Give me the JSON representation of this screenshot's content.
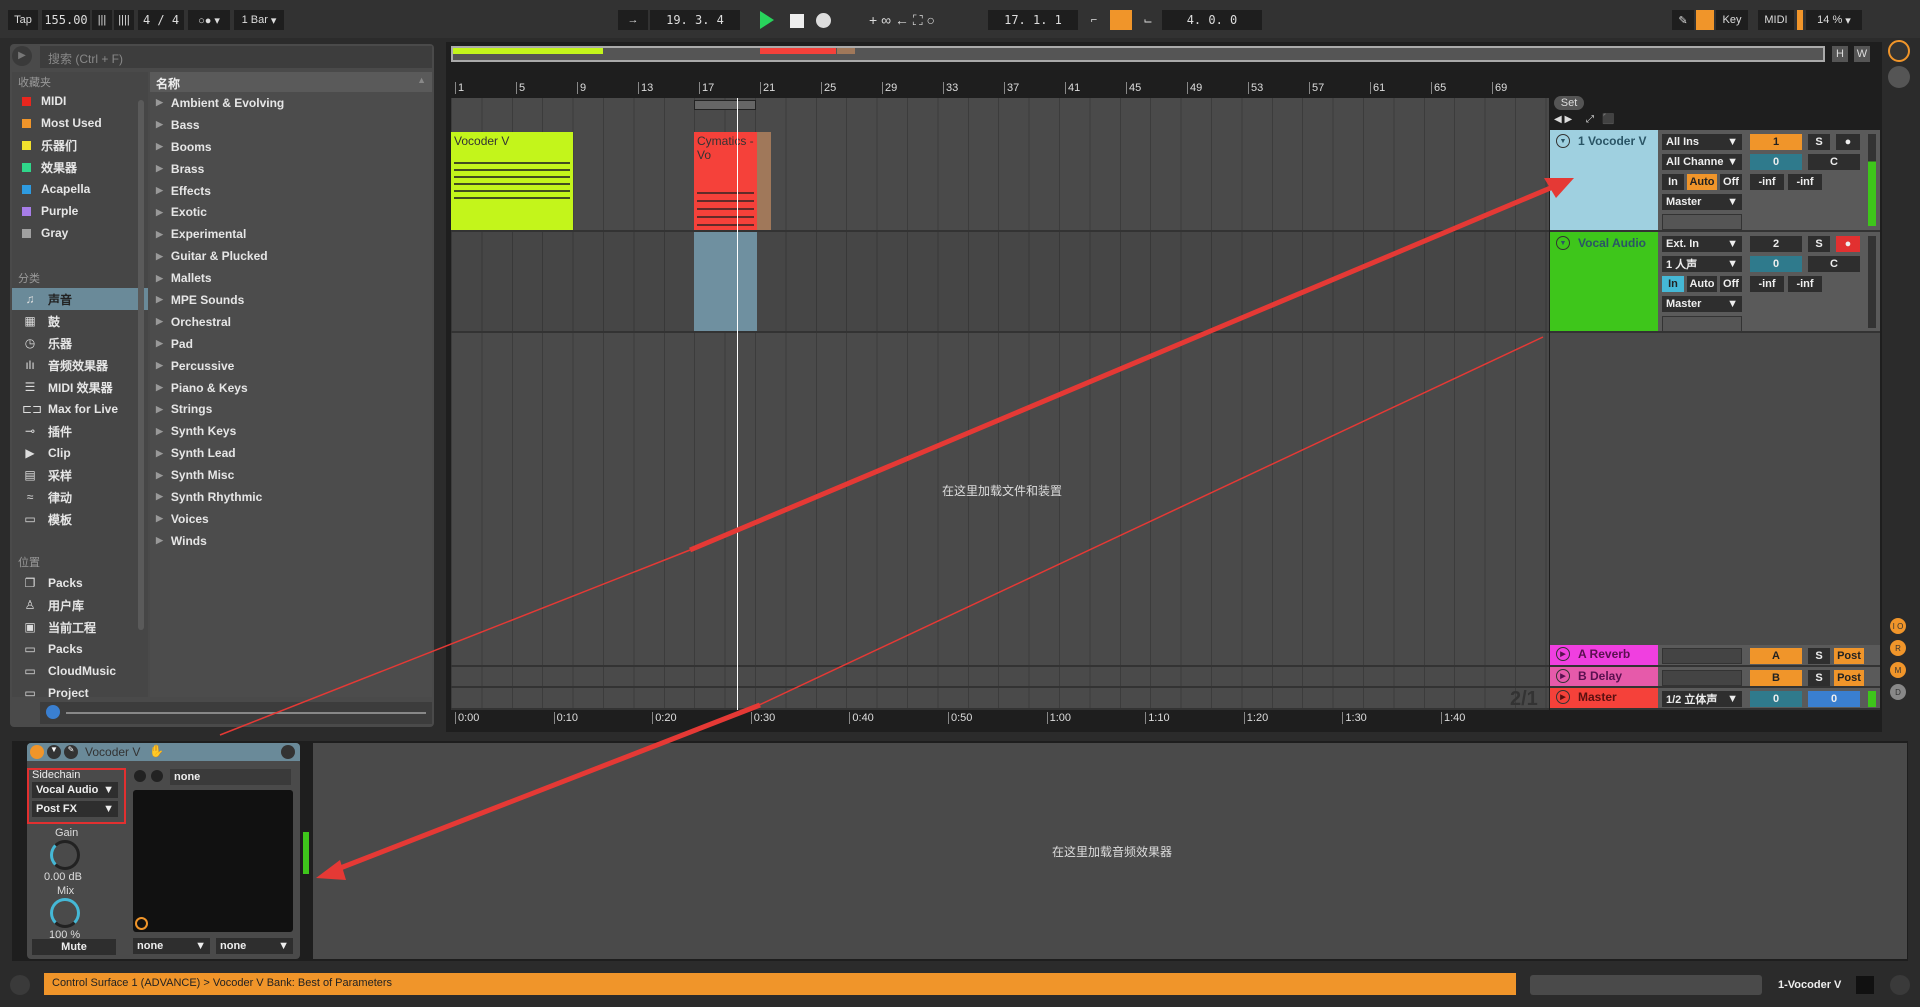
{
  "transport": {
    "tap": "Tap",
    "tempo": "155.00",
    "signature": "4 / 4",
    "quantize": "1 Bar",
    "position": "19. 3. 4",
    "loop_start": "17. 1. 1",
    "loop_length": "4. 0. 0",
    "key": "Key",
    "midi": "MIDI",
    "cpu": "14 %",
    "h": "H",
    "w": "W"
  },
  "browser": {
    "search_placeholder": "搜索 (Ctrl + F)",
    "collections_label": "收藏夹",
    "collections": [
      {
        "label": "MIDI",
        "color": "#e8261e"
      },
      {
        "label": "Most Used",
        "color": "#f0952a"
      },
      {
        "label": "乐器们",
        "color": "#f2e12d"
      },
      {
        "label": "效果器",
        "color": "#2fd68a"
      },
      {
        "label": "Acapella",
        "color": "#2e9be0"
      },
      {
        "label": "Purple",
        "color": "#a77de8"
      },
      {
        "label": "Gray",
        "color": "#a0a0a0"
      }
    ],
    "categories_label": "分类",
    "categories": [
      {
        "label": "声音",
        "icon": "♫"
      },
      {
        "label": "鼓",
        "icon": "▦"
      },
      {
        "label": "乐器",
        "icon": "◷"
      },
      {
        "label": "音频效果器",
        "icon": "ılı"
      },
      {
        "label": "MIDI 效果器",
        "icon": "☰"
      },
      {
        "label": "Max for Live",
        "icon": "⊏⊐"
      },
      {
        "label": "插件",
        "icon": "⊸"
      },
      {
        "label": "Clip",
        "icon": "▶"
      },
      {
        "label": "采样",
        "icon": "▤"
      },
      {
        "label": "律动",
        "icon": "≈"
      },
      {
        "label": "模板",
        "icon": "▭"
      }
    ],
    "places_label": "位置",
    "places": [
      {
        "label": "Packs",
        "icon": "❐"
      },
      {
        "label": "用户库",
        "icon": "♙"
      },
      {
        "label": "当前工程",
        "icon": "▣"
      },
      {
        "label": "Packs",
        "icon": "▭"
      },
      {
        "label": "CloudMusic",
        "icon": "▭"
      },
      {
        "label": "Project",
        "icon": "▭"
      }
    ],
    "name_header": "名称",
    "items": [
      "Ambient & Evolving",
      "Bass",
      "Booms",
      "Brass",
      "Effects",
      "Exotic",
      "Experimental",
      "Guitar & Plucked",
      "Mallets",
      "MPE Sounds",
      "Orchestral",
      "Pad",
      "Percussive",
      "Piano & Keys",
      "Strings",
      "Synth Keys",
      "Synth Lead",
      "Synth Misc",
      "Synth Rhythmic",
      "Voices",
      "Winds"
    ]
  },
  "arrangement": {
    "bar_labels": [
      "1",
      "5",
      "9",
      "13",
      "17",
      "21",
      "25",
      "29",
      "33",
      "37",
      "41",
      "45",
      "49",
      "53",
      "57",
      "61",
      "65",
      "69"
    ],
    "time_labels": [
      "0:00",
      "0:10",
      "0:20",
      "0:30",
      "0:40",
      "0:50",
      "1:00",
      "1:10",
      "1:20",
      "1:30",
      "1:40"
    ],
    "clips": [
      {
        "name": "Vocoder V",
        "color": "#c3f51b"
      },
      {
        "name": "Cymatics - Vo",
        "color": "#f5413a"
      }
    ],
    "drop_hint": "在这里加载文件和装置",
    "set": "Set",
    "zoom_ratio": "2/1"
  },
  "tracks": [
    {
      "name": "1 Vocoder V",
      "color": "#9fd0e0",
      "input": "All Ins",
      "channel": "All Channe",
      "in": "In",
      "auto": "Auto",
      "off": "Off",
      "output": "Master",
      "number": "1",
      "solo": "S",
      "vol": "0",
      "pan": "C",
      "peak1": "-inf",
      "peak2": "-inf",
      "monitor": "auto",
      "armed": false
    },
    {
      "name": "Vocal Audio",
      "color": "#3ec61b",
      "input": "Ext. In",
      "channel": "1 人声",
      "in": "In",
      "auto": "Auto",
      "off": "Off",
      "output": "Master",
      "number": "2",
      "solo": "S",
      "vol": "0",
      "pan": "C",
      "peak1": "-inf",
      "peak2": "-inf",
      "monitor": "in",
      "armed": true
    }
  ],
  "returns": [
    {
      "name": "A Reverb",
      "color": "#f03fe0",
      "send": "A",
      "solo": "S",
      "post": "Post"
    },
    {
      "name": "B Delay",
      "color": "#e65aaa",
      "send": "B",
      "solo": "S",
      "post": "Post"
    }
  ],
  "master": {
    "name": "Master",
    "color": "#f5413a",
    "output": "1/2 立体声",
    "vol": "0",
    "pan": "0"
  },
  "side_buttons": [
    "I O",
    "R",
    "M",
    "D"
  ],
  "device": {
    "name": "Vocoder V",
    "sidechain": "Sidechain",
    "source": "Vocal Audio",
    "tap": "Post FX",
    "gain_label": "Gain",
    "gain": "0.00 dB",
    "mix_label": "Mix",
    "mix": "100 %",
    "mute": "Mute",
    "preset": "none",
    "sel1": "none",
    "sel2": "none"
  },
  "fx_hint": "在这里加载音频效果器",
  "status": {
    "message": "Control Surface 1 (ADVANCE) > Vocoder V Bank: Best of Parameters",
    "selected_track": "1-Vocoder V"
  }
}
